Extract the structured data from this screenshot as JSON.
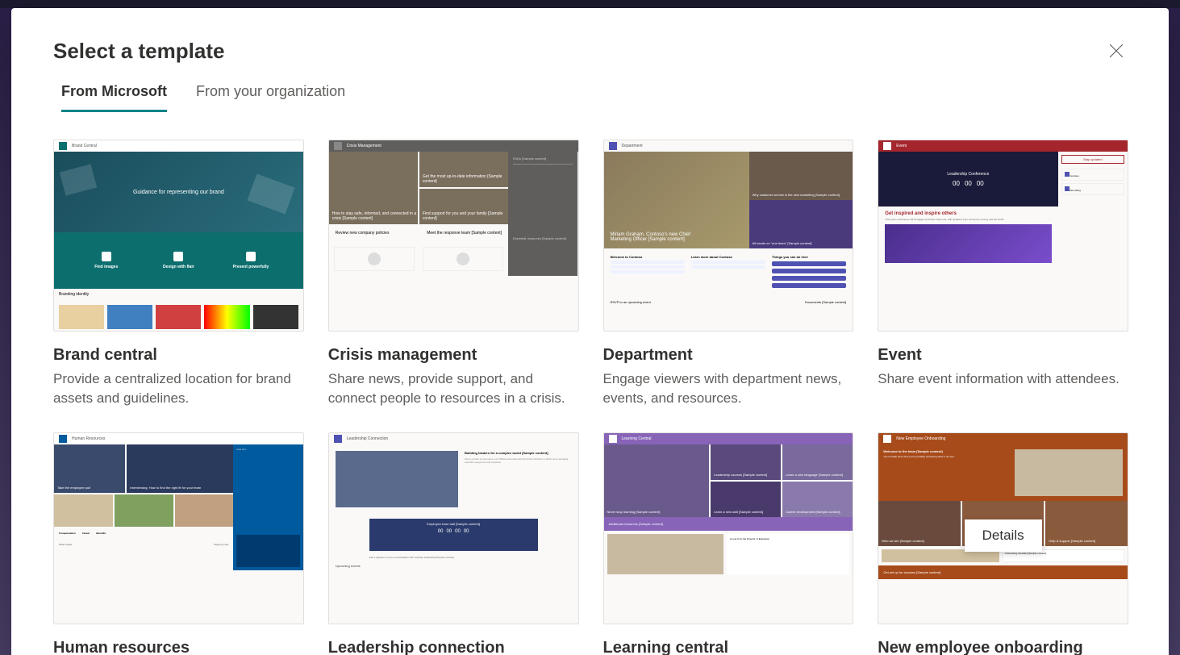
{
  "modal": {
    "title": "Select a template",
    "tabs": [
      {
        "label": "From Microsoft",
        "active": true
      },
      {
        "label": "From your organization",
        "active": false
      }
    ],
    "details_button": "Details"
  },
  "templates": [
    {
      "id": "brand-central",
      "title": "Brand central",
      "description": "Provide a centralized location for brand assets and guidelines.",
      "thumb": {
        "header_text": "Brand Central",
        "hero_text": "Guidance for representing our brand",
        "col1_title": "Find images",
        "col2_title": "Design with flair",
        "col3_title": "Present powerfully",
        "footer_label": "Branding identity"
      }
    },
    {
      "id": "crisis-management",
      "title": "Crisis management",
      "description": "Share news, provide support, and connect people to resources in a crisis.",
      "thumb": {
        "header_text": "Crisis Management",
        "tile1": "How to stay safe, informed, and connected in a crisis [Sample content]",
        "tile2": "Get the most up-to-date information [Sample content]",
        "tile3": "Find support for you and your family [Sample content]",
        "news_title": "Review new company policies",
        "team_title": "Meet the response team [Sample content]",
        "side_title": "FAQs [Sample content]",
        "side_res": "Essential resources [Sample content]"
      }
    },
    {
      "id": "department",
      "title": "Department",
      "description": "Engage viewers with department news, events, and resources.",
      "thumb": {
        "header_text": "Department",
        "hero_main": "Miriam Graham, Contoso's new Chief Marketing Officer [Sample content]",
        "hero_r1": "Why customer service is the new marketing [Sample content]",
        "hero_r2": "All hands on \"one team\" [Sample content]",
        "col1": "Welcome to Contoso",
        "col2": "Learn more about Contoso",
        "col3": "Things you can do here",
        "rsvp": "RSVP to an upcoming event",
        "docs": "Documents [Sample content]"
      }
    },
    {
      "id": "event",
      "title": "Event",
      "description": "Share event information with attendees.",
      "thumb": {
        "header_text": "Event",
        "hero_title": "Leadership Conference",
        "count": [
          "00",
          "00",
          "00"
        ],
        "red_text": "Get inspired and inspire others",
        "stay": "Stay updated",
        "side1": "Contoso",
        "side2": "Recruiting"
      }
    },
    {
      "id": "human-resources",
      "title": "Human resources",
      "description": "",
      "thumb": {
        "header_text": "Human Resources",
        "tile1": "Take the employee poll",
        "tile2": "Interviewing: How to find the right fit for your team",
        "side_title": "How do I…",
        "link1": "Compensation",
        "link2": "Career",
        "link3": "Benefits",
        "topics": "Other topics",
        "roles": "Topics by role"
      }
    },
    {
      "id": "leadership-connection",
      "title": "Leadership connection",
      "description": "",
      "thumb": {
        "header_text": "Leadership Connection",
        "heading": "Building leaders for a complex world [Sample content]",
        "townhall": "Employee town hall [Sample content]",
        "count": [
          "00",
          "00",
          "00",
          "00"
        ],
        "ask": "Ask a question or join a conversation with Contoso leadership [Sample content]",
        "events": "Upcoming events"
      }
    },
    {
      "id": "learning-central",
      "title": "Learning central",
      "description": "",
      "thumb": {
        "header_text": "Learning Central",
        "tile_main": "Never stop learning [Sample content]",
        "tile_2": "Leadership courses [Sample content]",
        "tile_3": "Learn a new language [Sample content]",
        "tile_4": "Learn a new skill [Sample content]",
        "tile_5": "Career development [Sample content]",
        "res": "Additional resources [Sample content]",
        "note": "A note from the Director of Education"
      }
    },
    {
      "id": "new-employee-onboarding",
      "title": "New employee onboarding",
      "description": "",
      "thumb": {
        "header_text": "New Employee Onboarding",
        "welcome": "Welcome to the team [Sample content]",
        "tile1": "Who we are [Sample content]",
        "tile2": "Our priorities [Sample content]",
        "tile3": "Help & support [Sample content]",
        "foot": "Get set up for success [Sample content]",
        "checklist": "Onboarding checklist [Sample content]"
      }
    }
  ]
}
